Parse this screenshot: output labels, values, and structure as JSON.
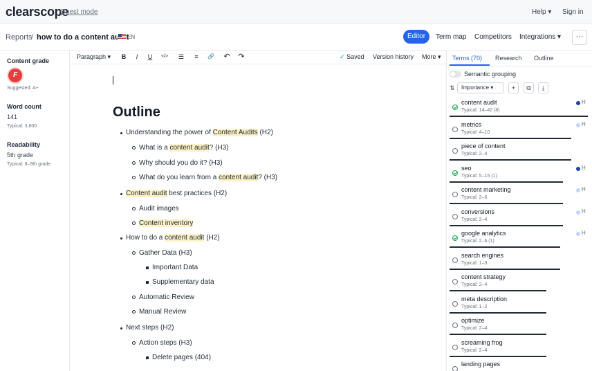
{
  "app": {
    "logo": "clearscope",
    "guest_mode": "Guest mode",
    "help": "Help",
    "sign_in": "Sign in"
  },
  "breadcrumb": {
    "reports": "Reports",
    "separator": "/",
    "title": "how to do a content audit",
    "language": "EN"
  },
  "nav": {
    "editor": "Editor",
    "term_map": "Term map",
    "competitors": "Competitors",
    "integrations": "Integrations",
    "more": "···"
  },
  "left_panel": {
    "content_grade_label": "Content grade",
    "grade": "F",
    "suggested": "Suggested: A+",
    "word_count_label": "Word count",
    "word_count": "141",
    "word_count_typical": "Typical: 3,800",
    "readability_label": "Readability",
    "readability": "5th grade",
    "readability_typical": "Typical: 8–9th grade"
  },
  "toolbar": {
    "paragraph": "Paragraph",
    "bold": "B",
    "italic": "I",
    "underline": "U",
    "code": "</>",
    "bullet_list": "☰",
    "ordered_list": "≡",
    "link": "🔗",
    "undo": "↶",
    "redo": "↷",
    "saved": "Saved",
    "version_history": "Version history",
    "more": "More"
  },
  "document": {
    "heading": "Outline",
    "lines": [
      {
        "pre": "Understanding the power of ",
        "hl": "Content Audits",
        "post": " (H2)"
      },
      {
        "pre": "What is a ",
        "hl": "content audit",
        "post": "? (H3)"
      },
      {
        "pre": "Why should you do it? (H3)",
        "hl": "",
        "post": ""
      },
      {
        "pre": "What do you learn from a ",
        "hl": "content audit",
        "post": "? (H3)"
      },
      {
        "pre": "",
        "hl": "Content audit",
        "post": " best practices (H2)"
      },
      {
        "pre": "Audit images",
        "hl": "",
        "post": ""
      },
      {
        "pre": "",
        "hl": "Content inventory",
        "post": ""
      },
      {
        "pre": "How to do a ",
        "hl": "content audit",
        "post": " (H2)"
      },
      {
        "pre": "Gather Data (H3)",
        "hl": "",
        "post": ""
      },
      {
        "pre": "Important Data",
        "hl": "",
        "post": ""
      },
      {
        "pre": "Supplementary data",
        "hl": "",
        "post": ""
      },
      {
        "pre": "Automatic Review",
        "hl": "",
        "post": ""
      },
      {
        "pre": "Manual Review",
        "hl": "",
        "post": ""
      },
      {
        "pre": "Next steps (H2)",
        "hl": "",
        "post": ""
      },
      {
        "pre": "Action steps (H3)",
        "hl": "",
        "post": ""
      },
      {
        "pre": "Delete pages (404)",
        "hl": "",
        "post": ""
      }
    ]
  },
  "right_panel": {
    "tabs": [
      "Terms (70)",
      "Research",
      "Outline"
    ],
    "semantic_grouping": "Semantic grouping",
    "sort": "Importance",
    "terms": [
      {
        "name": "content audit",
        "typical": "Typical: 14–42 (8)",
        "done": true,
        "h": "H",
        "dot": "#1e40af",
        "progress": 1.0
      },
      {
        "name": "metrics",
        "typical": "Typical: 4–10",
        "done": false,
        "h": "H",
        "dot": "#c7d2fe",
        "progress": 0.88
      },
      {
        "name": "piece of content",
        "typical": "Typical: 2–4",
        "done": false,
        "h": "",
        "dot": "",
        "progress": 0.88
      },
      {
        "name": "seo",
        "typical": "Typical: 5–15 (1)",
        "done": true,
        "h": "H",
        "dot": "#1e40af",
        "progress": 0.82
      },
      {
        "name": "content marketing",
        "typical": "Typical: 2–6",
        "done": false,
        "h": "H",
        "dot": "#c7d2fe",
        "progress": 0.82
      },
      {
        "name": "conversions",
        "typical": "Typical: 2–4",
        "done": false,
        "h": "H",
        "dot": "#c7d2fe",
        "progress": 0.82
      },
      {
        "name": "google analytics",
        "typical": "Typical: 2–6 (1)",
        "done": true,
        "h": "H",
        "dot": "#c7d2fe",
        "progress": 0.8
      },
      {
        "name": "search engines",
        "typical": "Typical: 1–3",
        "done": false,
        "h": "",
        "dot": "",
        "progress": 0.8
      },
      {
        "name": "content strategy",
        "typical": "Typical: 2–4",
        "done": false,
        "h": "",
        "dot": "",
        "progress": 0.7
      },
      {
        "name": "meta description",
        "typical": "Typical: 1–2",
        "done": false,
        "h": "",
        "dot": "",
        "progress": 0.7
      },
      {
        "name": "optimize",
        "typical": "Typical: 2–4",
        "done": false,
        "h": "",
        "dot": "",
        "progress": 0.7
      },
      {
        "name": "screaming frog",
        "typical": "Typical: 2–4",
        "done": false,
        "h": "",
        "dot": "",
        "progress": 0.7
      },
      {
        "name": "landing pages",
        "typical": "",
        "done": false,
        "h": "",
        "dot": "",
        "progress": 0.7
      }
    ]
  }
}
